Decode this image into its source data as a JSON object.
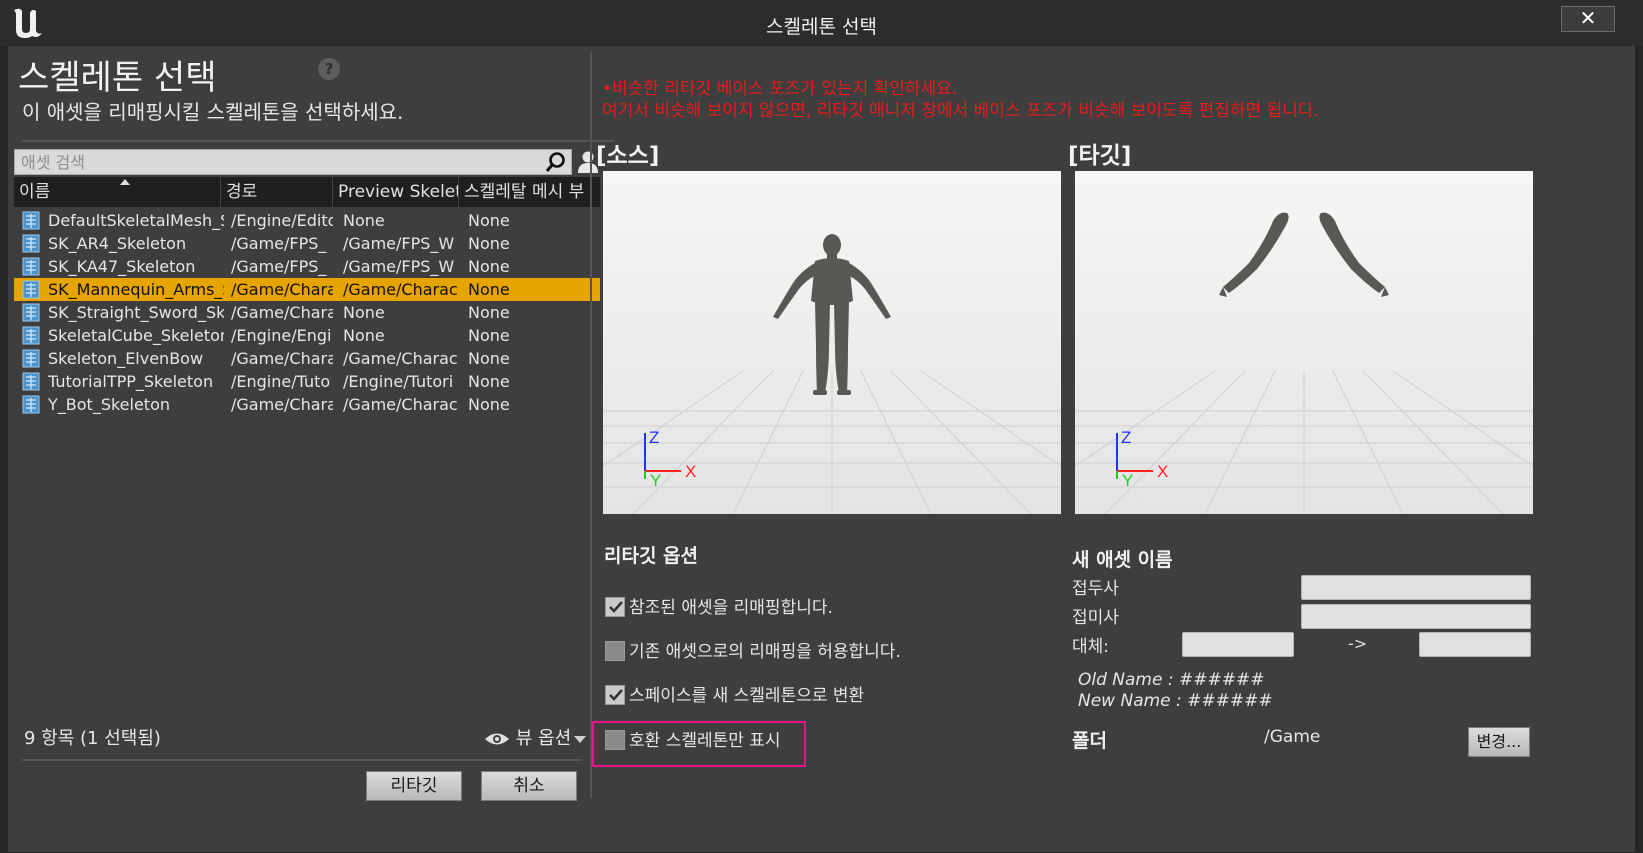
{
  "window": {
    "title": "스켈레톤 선택",
    "close_label": "✕"
  },
  "left": {
    "title": "스켈레톤 선택",
    "help_icon": "?",
    "subtitle": "이 애셋을 리매핑시킬 스켈레톤을 선택하세요.",
    "search_placeholder": "애셋 검색",
    "columns": [
      "이름",
      "경로",
      "Preview Skeleta",
      "스켈레탈 메시 부"
    ],
    "rows": [
      {
        "name": "DefaultSkeletalMesh_S",
        "path": "/Engine/Edito",
        "preview": "None",
        "mesh": "None",
        "selected": false
      },
      {
        "name": "SK_AR4_Skeleton",
        "path": "/Game/FPS_",
        "preview": "/Game/FPS_W",
        "mesh": "None",
        "selected": false
      },
      {
        "name": "SK_KA47_Skeleton",
        "path": "/Game/FPS_",
        "preview": "/Game/FPS_W",
        "mesh": "None",
        "selected": false
      },
      {
        "name": "SK_Mannequin_Arms_S",
        "path": "/Game/Chara",
        "preview": "/Game/Charac",
        "mesh": "None",
        "selected": true
      },
      {
        "name": "SK_Straight_Sword_Sk",
        "path": "/Game/Chara",
        "preview": "None",
        "mesh": "None",
        "selected": false
      },
      {
        "name": "SkeletalCube_Skeleton",
        "path": "/Engine/Engi",
        "preview": "None",
        "mesh": "None",
        "selected": false
      },
      {
        "name": "Skeleton_ElvenBow",
        "path": "/Game/Chara",
        "preview": "/Game/Charac",
        "mesh": "None",
        "selected": false
      },
      {
        "name": "TutorialTPP_Skeleton",
        "path": "/Engine/Tuto",
        "preview": "/Engine/Tutori",
        "mesh": "None",
        "selected": false
      },
      {
        "name": "Y_Bot_Skeleton",
        "path": "/Game/Chara",
        "preview": "/Game/Charac",
        "mesh": "None",
        "selected": false
      }
    ],
    "item_count": "9 항목 (1 선택됨)",
    "view_options": "뷰 옵션",
    "retarget_button": "리타깃",
    "cancel_button": "취소"
  },
  "right": {
    "warning_line1": "•비슷한 리타깃 베이스 포즈가 있는지 확인하세요.",
    "warning_line2": "여기서 비슷해 보이지 않으면, 리타깃 매니저 창에서 베이스 포즈가 비슷해 보이도록 편집하면 됩니다.",
    "source_label": "[소스]",
    "target_label": "[타깃]",
    "axis_z": "Z",
    "axis_x": "X",
    "axis_y": "Y",
    "options_title": "리타깃 옵션",
    "options": [
      {
        "label": "참조된 애셋을 리매핑합니다.",
        "checked": true
      },
      {
        "label": "기존 애셋으로의 리매핑을 허용합니다.",
        "checked": false
      },
      {
        "label": "스페이스를 새 스켈레톤으로 변환",
        "checked": true
      },
      {
        "label": "호환 스켈레톤만 표시",
        "checked": false
      }
    ],
    "new_asset_title": "새 애셋 이름",
    "prefix_label": "접두사",
    "suffix_label": "접미사",
    "replace_label": "대체:",
    "replace_arrow": "->",
    "old_name": "Old Name : ######",
    "new_name": "New Name : ######",
    "folder_label": "폴더",
    "folder_value": "/Game",
    "change_button": "변경..."
  },
  "colors": {
    "selection": "#e5a400",
    "warning": "#e81c1c",
    "highlight_box": "#e8148c"
  }
}
